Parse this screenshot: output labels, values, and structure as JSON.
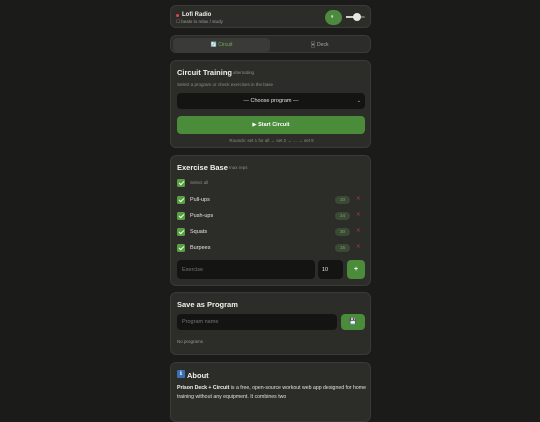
{
  "radio": {
    "title": "Lofi Radio",
    "subtitle": "beats to relax / study",
    "play_glyph": "⏸",
    "volume": 0.6
  },
  "tabs": [
    {
      "label": "🔄 Circuit",
      "active": true
    },
    {
      "label": "🃏 Deck",
      "active": false
    }
  ],
  "circuit": {
    "title": "Circuit Training",
    "mode": "alternating",
    "description": "Select a program or check exercises in the base",
    "select_value": "— Choose program —",
    "start_label": "▶ Start Circuit",
    "rounds_text": "Rounds: set 1 for all → set 2 → ... → set 9"
  },
  "base": {
    "title": "Exercise Base",
    "mode": "max reps",
    "select_all": "Select all",
    "exercises": [
      {
        "name": "Pull-ups",
        "reps": "10"
      },
      {
        "name": "Push-ups",
        "reps": "24"
      },
      {
        "name": "Squats",
        "reps": "30"
      },
      {
        "name": "Burpees",
        "reps": "15"
      }
    ],
    "delete_glyph": "✕",
    "input_placeholder": "Exercise",
    "number_value": "10",
    "add_label": "+"
  },
  "save": {
    "title": "Save as Program",
    "input_placeholder": "Program name",
    "save_glyph": "💾",
    "empty_text": "No programs"
  },
  "about": {
    "icon": "ℹ",
    "title": "About",
    "app_name": "Prison Deck + Circuit",
    "text": " is a free, open-source workout web app designed for home training without any equipment. It combines two"
  },
  "colors": {
    "accent": "#4a8c3a",
    "background": "#1b1b19",
    "card": "#2c2c29",
    "danger": "#b33a3a"
  }
}
